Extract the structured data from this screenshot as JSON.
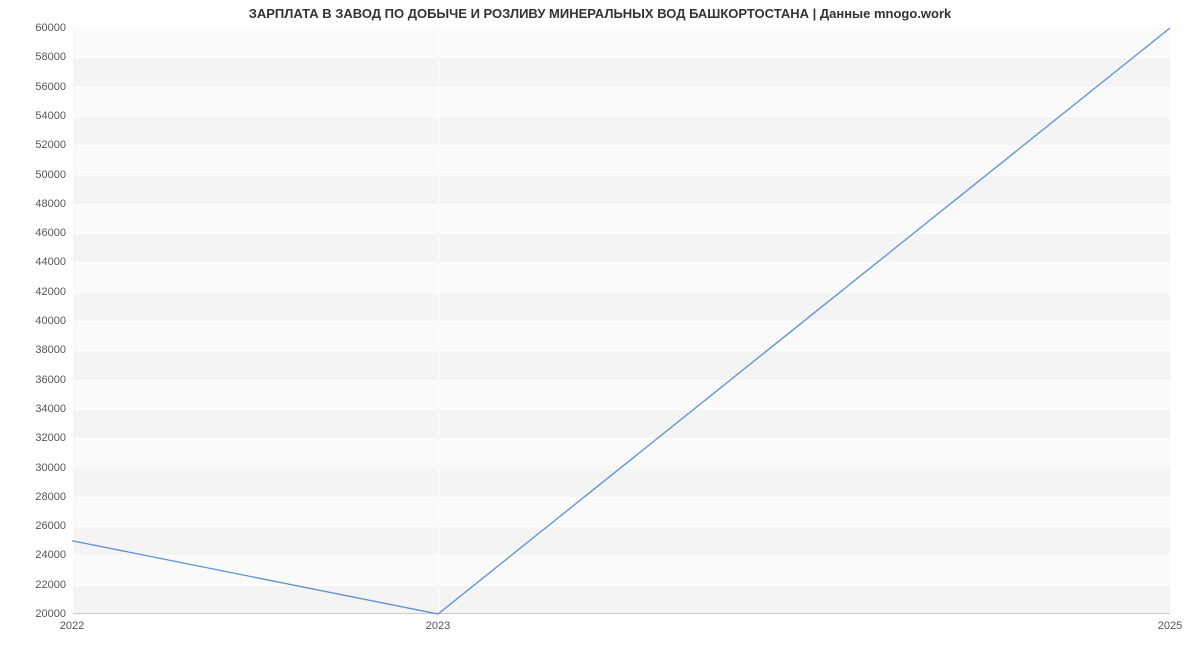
{
  "chart_data": {
    "type": "line",
    "title": "ЗАРПЛАТА В ЗАВОД ПО ДОБЫЧЕ И РОЗЛИВУ МИНЕРАЛЬНЫХ ВОД БАШКОРТОСТАНА | Данные mnogo.work",
    "xlabel": "",
    "ylabel": "",
    "x": [
      2022,
      2023,
      2025
    ],
    "values": [
      25000,
      20000,
      60000
    ],
    "y_ticks": [
      20000,
      22000,
      24000,
      26000,
      28000,
      30000,
      32000,
      34000,
      36000,
      38000,
      40000,
      42000,
      44000,
      46000,
      48000,
      50000,
      52000,
      54000,
      56000,
      58000,
      60000
    ],
    "x_ticks": [
      2022,
      2023,
      2025
    ],
    "xlim": [
      2022,
      2025
    ],
    "ylim": [
      20000,
      60000
    ],
    "grid": true,
    "line_color": "#5b8fd6"
  }
}
